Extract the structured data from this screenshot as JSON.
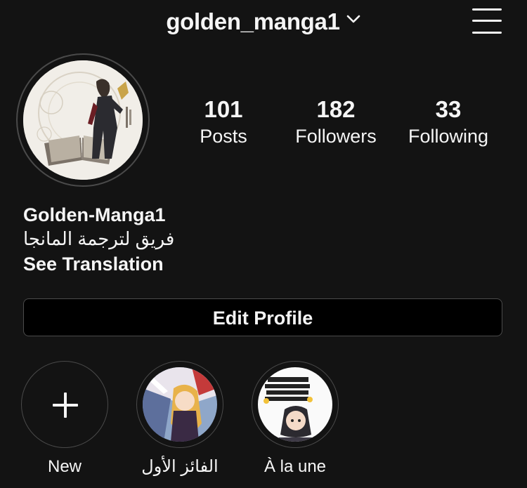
{
  "header": {
    "username": "golden_manga1",
    "dropdown_icon": "chevron-down-icon",
    "menu_icon": "hamburger-menu-icon"
  },
  "profile": {
    "avatar_alt": "profile-picture"
  },
  "stats": [
    {
      "count": "101",
      "label": "Posts"
    },
    {
      "count": "182",
      "label": "Followers"
    },
    {
      "count": "33",
      "label": "Following"
    }
  ],
  "bio": {
    "display_name": "Golden-Manga1",
    "description": "فريق لترجمة المانجا",
    "see_translation": "See Translation"
  },
  "edit_profile": {
    "label": "Edit Profile"
  },
  "highlights": [
    {
      "label": "New",
      "icon": "plus-icon"
    },
    {
      "label": "الفائز الأول"
    },
    {
      "label": "À la une"
    }
  ],
  "colors": {
    "background": "#131313",
    "text": "#f5f5f5",
    "ring": "#4a4a4a",
    "button_background": "#000000"
  }
}
